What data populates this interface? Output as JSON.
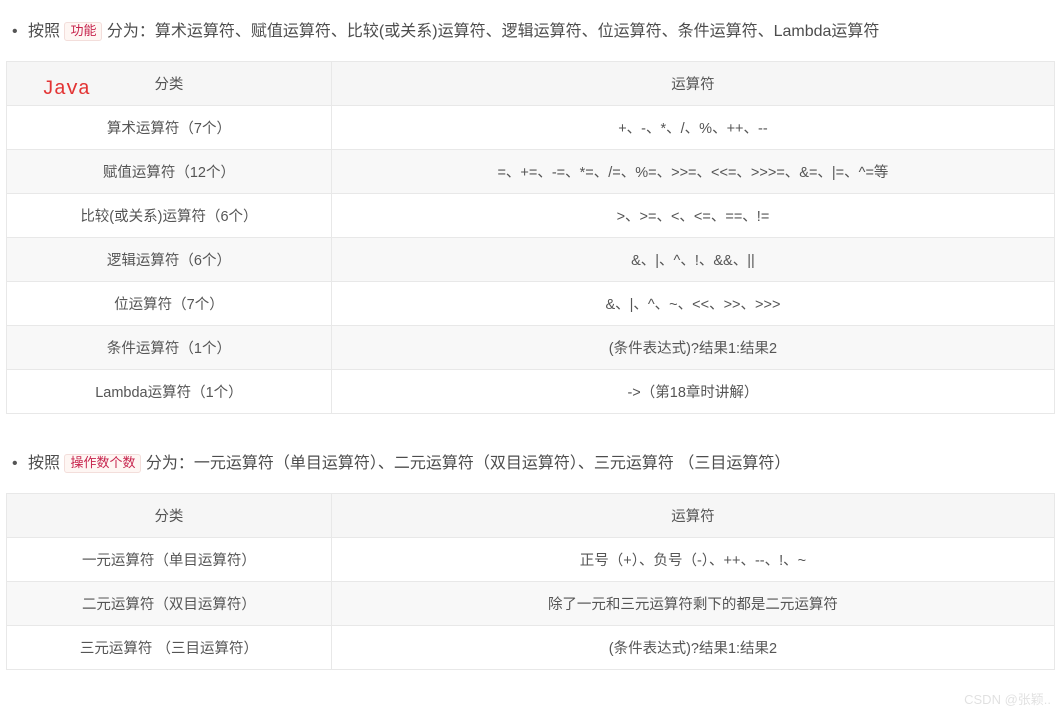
{
  "section1": {
    "intro_prefix": "按照 ",
    "intro_keyword": "功能",
    "intro_suffix": " 分为：算术运算符、赋值运算符、比较(或关系)运算符、逻辑运算符、位运算符、条件运算符、Lambda运算符",
    "java_label": "Java",
    "table": {
      "headers": [
        "分类",
        "运算符"
      ],
      "rows": [
        {
          "c": "算术运算符（7个）",
          "o": "+、-、*、/、%、++、--"
        },
        {
          "c": "赋值运算符（12个）",
          "o": "=、+=、-=、*=、/=、%=、>>=、<<=、>>>=、&=、|=、^=等"
        },
        {
          "c": "比较(或关系)运算符（6个）",
          "o": ">、>=、<、<=、==、!="
        },
        {
          "c": "逻辑运算符（6个）",
          "o": "&、|、^、!、&&、||"
        },
        {
          "c": "位运算符（7个）",
          "o": "&、|、^、~、<<、>>、>>>"
        },
        {
          "c": "条件运算符（1个）",
          "o": "(条件表达式)?结果1:结果2"
        },
        {
          "c": "Lambda运算符（1个）",
          "o": "->（第18章时讲解）"
        }
      ]
    }
  },
  "section2": {
    "intro_prefix": "按照 ",
    "intro_keyword": "操作数个数",
    "intro_suffix": " 分为：一元运算符（单目运算符）、二元运算符（双目运算符）、三元运算符 （三目运算符）",
    "table": {
      "headers": [
        "分类",
        "运算符"
      ],
      "rows": [
        {
          "c": "一元运算符（单目运算符）",
          "o": "正号（+）、负号（-）、++、--、!、~"
        },
        {
          "c": "二元运算符（双目运算符）",
          "o": "除了一元和三元运算符剩下的都是二元运算符"
        },
        {
          "c": "三元运算符 （三目运算符）",
          "o": "(条件表达式)?结果1:结果2"
        }
      ]
    }
  },
  "watermark": "CSDN @张颖.."
}
